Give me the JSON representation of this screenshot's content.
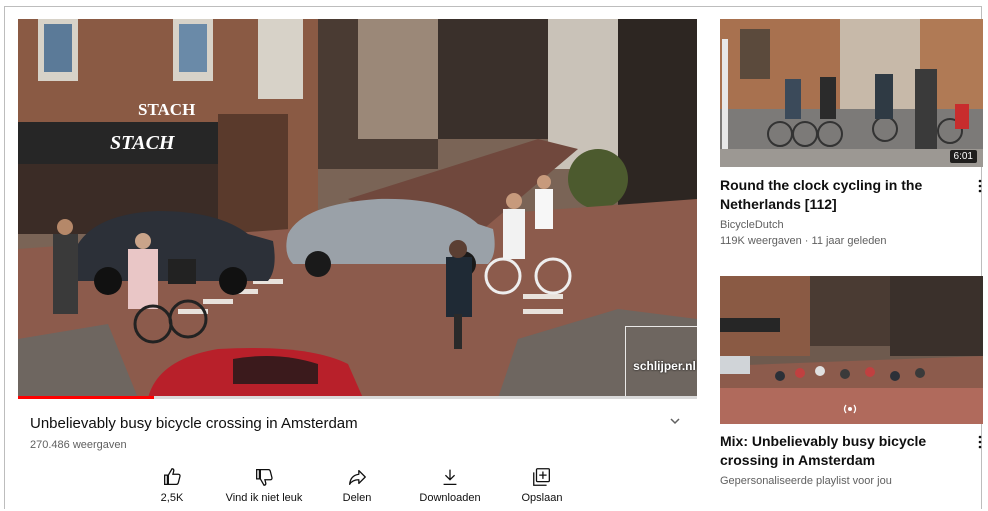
{
  "video": {
    "title": "Unbelievably busy bicycle crossing in Amsterdam",
    "views": "270.486 weergaven",
    "watermark": "schlijper.nl",
    "store_signs": [
      "STACH",
      "STACH"
    ],
    "progress_fraction": 0.2
  },
  "actions": [
    {
      "label": "2,5K",
      "icon": "thumbs-up-icon"
    },
    {
      "label": "Vind ik niet leuk",
      "icon": "thumbs-down-icon"
    },
    {
      "label": "Delen",
      "icon": "share-icon"
    },
    {
      "label": "Downloaden",
      "icon": "download-icon"
    },
    {
      "label": "Opslaan",
      "icon": "save-playlist-icon"
    }
  ],
  "sidebar": {
    "items": [
      {
        "title": "Round the clock cycling in the Netherlands [112]",
        "channel": "BicycleDutch",
        "meta": "119K weergaven · 11 jaar geleden",
        "duration": "6:01"
      },
      {
        "title": "Mix: Unbelievably busy bicycle crossing in Amsterdam",
        "channel": "Gepersonaliseerde playlist voor jou"
      }
    ]
  },
  "colors": {
    "progress": "#ff0000",
    "text_primary": "#0f0f0f",
    "text_secondary": "#606060"
  }
}
